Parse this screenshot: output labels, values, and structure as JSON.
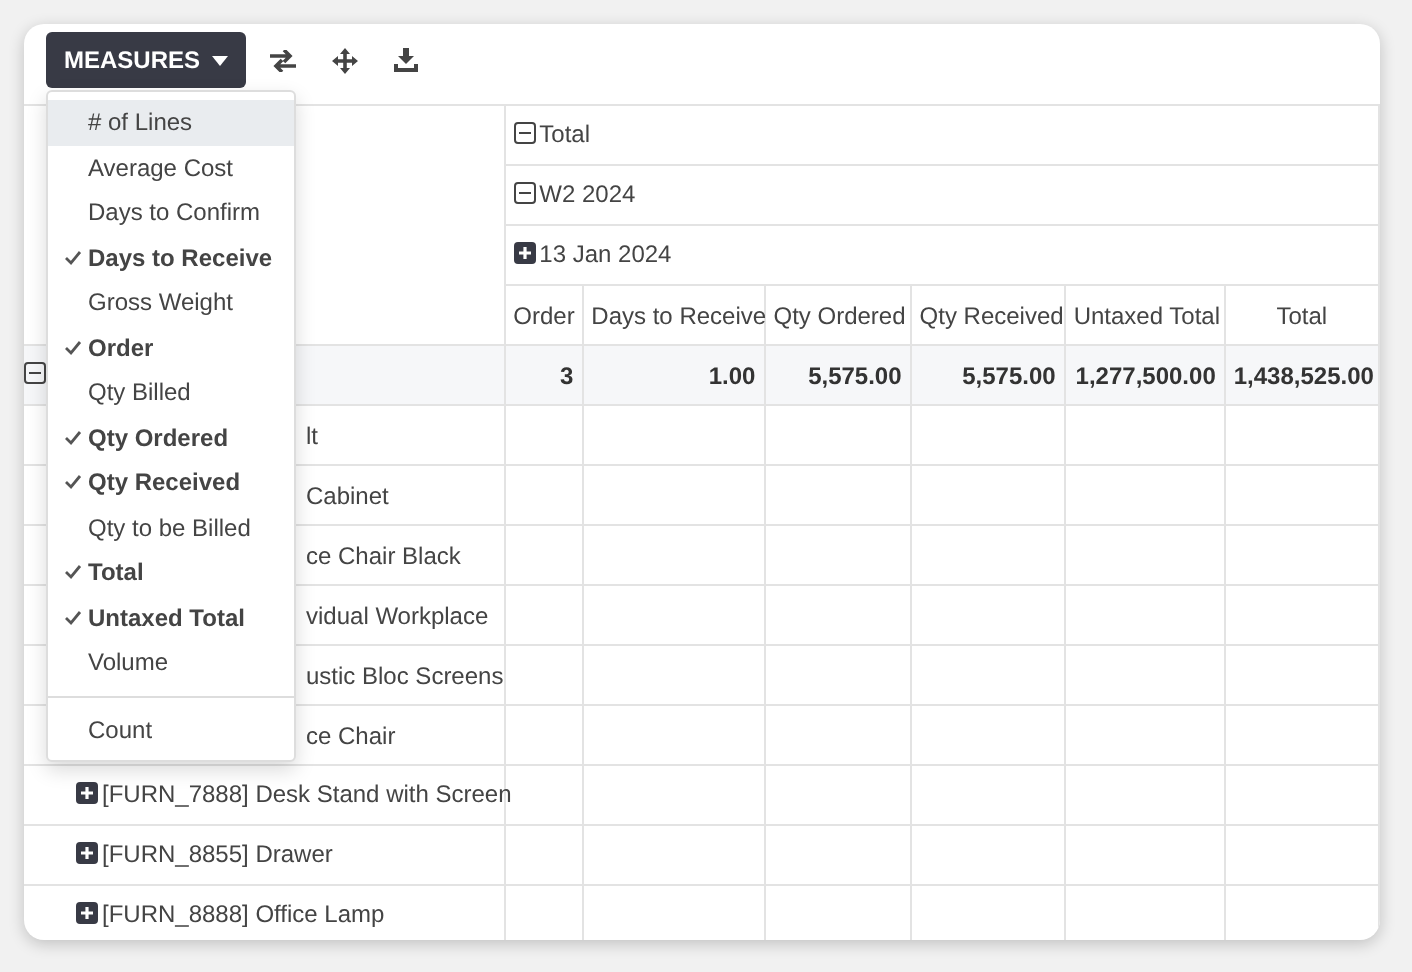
{
  "toolbar": {
    "measures_button": "MEASURES"
  },
  "measures_menu": {
    "items": [
      {
        "label": "# of Lines",
        "checked": false,
        "highlighted": true
      },
      {
        "label": "Average Cost",
        "checked": false,
        "highlighted": false
      },
      {
        "label": "Days to Confirm",
        "checked": false,
        "highlighted": false
      },
      {
        "label": "Days to Receive",
        "checked": true,
        "highlighted": false
      },
      {
        "label": "Gross Weight",
        "checked": false,
        "highlighted": false
      },
      {
        "label": "Order",
        "checked": true,
        "highlighted": false
      },
      {
        "label": "Qty Billed",
        "checked": false,
        "highlighted": false
      },
      {
        "label": "Qty Ordered",
        "checked": true,
        "highlighted": false
      },
      {
        "label": "Qty Received",
        "checked": true,
        "highlighted": false
      },
      {
        "label": "Qty to be Billed",
        "checked": false,
        "highlighted": false
      },
      {
        "label": "Total",
        "checked": true,
        "highlighted": false
      },
      {
        "label": "Untaxed Total",
        "checked": true,
        "highlighted": false
      },
      {
        "label": "Volume",
        "checked": false,
        "highlighted": false
      }
    ],
    "footer_items": [
      {
        "label": "Count",
        "checked": false,
        "highlighted": false
      }
    ]
  },
  "table": {
    "column_headers": [
      {
        "label": "Total",
        "expanded": true
      },
      {
        "label": "W2 2024",
        "expanded": true
      },
      {
        "label": "13 Jan 2024",
        "expanded": false
      }
    ],
    "measures": [
      "Order",
      "Days to Receive",
      "Qty Ordered",
      "Qty Received",
      "Untaxed Total",
      "Total"
    ],
    "total_row": {
      "expanded": true,
      "values": [
        "3",
        "1.00",
        "5,575.00",
        "5,575.00",
        "1,277,500.00",
        "1,438,525.00"
      ]
    },
    "rows": [
      {
        "kind": "covered",
        "label": "lt"
      },
      {
        "kind": "covered",
        "label": "Cabinet"
      },
      {
        "kind": "covered",
        "label": "ce Chair Black"
      },
      {
        "kind": "covered",
        "label": "vidual Workplace"
      },
      {
        "kind": "covered",
        "label": "ustic Bloc Screens"
      },
      {
        "kind": "covered",
        "label": "ce Chair"
      },
      {
        "kind": "group",
        "label": "[FURN_7888] Desk Stand with Screen",
        "expanded": false
      },
      {
        "kind": "group",
        "label": "[FURN_8855] Drawer",
        "expanded": false
      },
      {
        "kind": "group",
        "label": "[FURN_8888] Office Lamp",
        "expanded": false
      }
    ]
  }
}
